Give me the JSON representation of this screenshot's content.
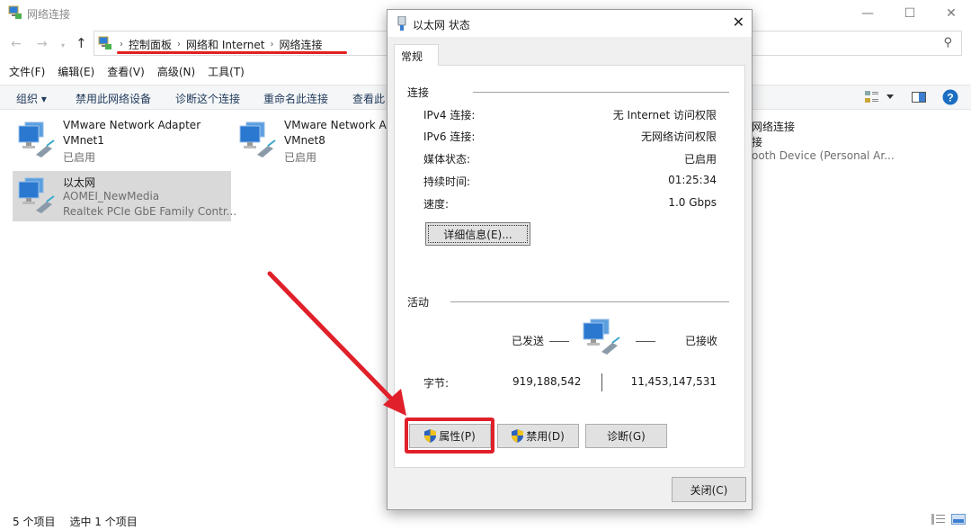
{
  "window": {
    "title": "网络连接",
    "controls": {
      "minimize": "—",
      "maximize": "☐",
      "close": "✕"
    }
  },
  "navigation": {
    "back": "←",
    "forward": "→",
    "recent": "▾",
    "up": "↑",
    "breadcrumb": [
      "控制面板",
      "网络和 Internet",
      "网络连接"
    ],
    "separator": "›",
    "search_icon": "⚲"
  },
  "menubar": [
    "文件(F)",
    "编辑(E)",
    "查看(V)",
    "高级(N)",
    "工具(T)"
  ],
  "commandbar": {
    "items": [
      "组织 ▾",
      "禁用此网络设备",
      "诊断这个连接",
      "重命名此连接",
      "查看此"
    ],
    "help_icon": "?"
  },
  "connections": [
    {
      "name": "VMware Network Adapter",
      "sub": "VMnet1",
      "status": "已启用",
      "selected": false
    },
    {
      "name": "VMware Network Ac",
      "sub": "VMnet8",
      "status": "已启用",
      "selected": false
    },
    {
      "name": "网络连接",
      "sub": "接",
      "status": "ooth Device (Personal Ar...",
      "selected": false
    },
    {
      "name": "以太网",
      "sub": "AOMEI_NewMedia",
      "status": "Realtek PCIe GbE Family Contr...",
      "selected": true
    }
  ],
  "statusbar": {
    "count": "5 个项目",
    "selected": "选中 1 个项目"
  },
  "dialog": {
    "title": "以太网 状态",
    "close": "✕",
    "tab": "常规",
    "connection_group": "连接",
    "rows": [
      {
        "label": "IPv4 连接:",
        "value": "无 Internet 访问权限"
      },
      {
        "label": "IPv6 连接:",
        "value": "无网络访问权限"
      },
      {
        "label": "媒体状态:",
        "value": "已启用"
      },
      {
        "label": "持续时间:",
        "value": "01:25:34"
      },
      {
        "label": "速度:",
        "value": "1.0 Gbps"
      }
    ],
    "details_button": "详细信息(E)...",
    "activity_group": "活动",
    "sent_label": "已发送",
    "received_label": "已接收",
    "bytes_label": "字节:",
    "bytes_sent": "919,188,542",
    "bytes_received": "11,453,147,531",
    "properties_button": "属性(P)",
    "disable_button": "禁用(D)",
    "diagnose_button": "诊断(G)",
    "close_button": "关闭(C)"
  },
  "annotation": {
    "color": "#e0202a"
  }
}
